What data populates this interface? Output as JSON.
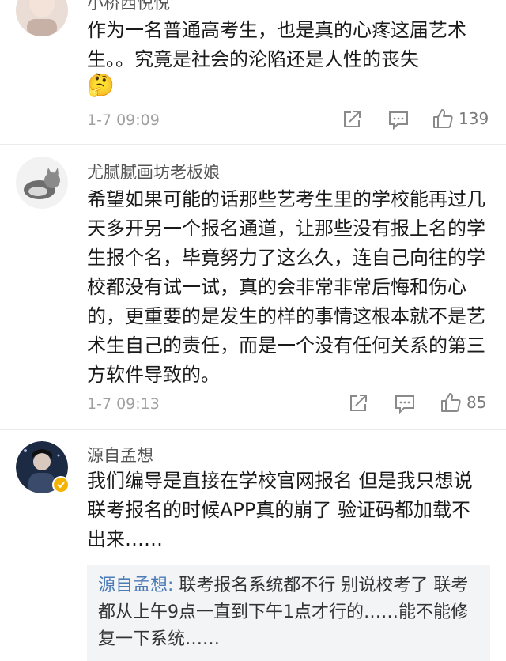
{
  "comments": [
    {
      "username": "小桥西悦悦",
      "text": "作为一名普通高考生，也是真的心疼这届艺术生。。究竟是社会的沦陷还是人性的丧失",
      "emoji": "🤔",
      "time": "1-7 09:09",
      "likes": "139"
    },
    {
      "username": "尤腻腻画坊老板娘",
      "text": "希望如果可能的话那些艺考生里的学校能再过几天多开另一个报名通道，让那些没有报上名的学生报个名，毕竟努力了这么久，连自己向往的学校都没有试一试，真的会非常非常后悔和伤心的，更重要的是发生的样的事情这根本就不是艺术生自己的责任，而是一个没有任何关系的第三方软件导致的。",
      "time": "1-7 09:13",
      "likes": "85"
    },
    {
      "username": "源自孟想",
      "text": "我们编导是直接在学校官网报名 但是我只想说 联考报名的时候APP真的崩了 验证码都加载不出来……",
      "reply": {
        "name": "源自孟想:",
        "text": " 联考报名系统都不行 别说校考了 联考都从上午9点一直到下午1点才行的……能不能修复一下系统……"
      }
    }
  ],
  "icons": {
    "repost": "share-arrow-icon",
    "comment": "comment-bubble-icon",
    "like": "thumbs-up-icon",
    "verified": "verified-badge-icon"
  },
  "colors": {
    "verified": "#f5b300",
    "reply_name": "#4c7bb8",
    "muted": "#a0a0a0"
  }
}
